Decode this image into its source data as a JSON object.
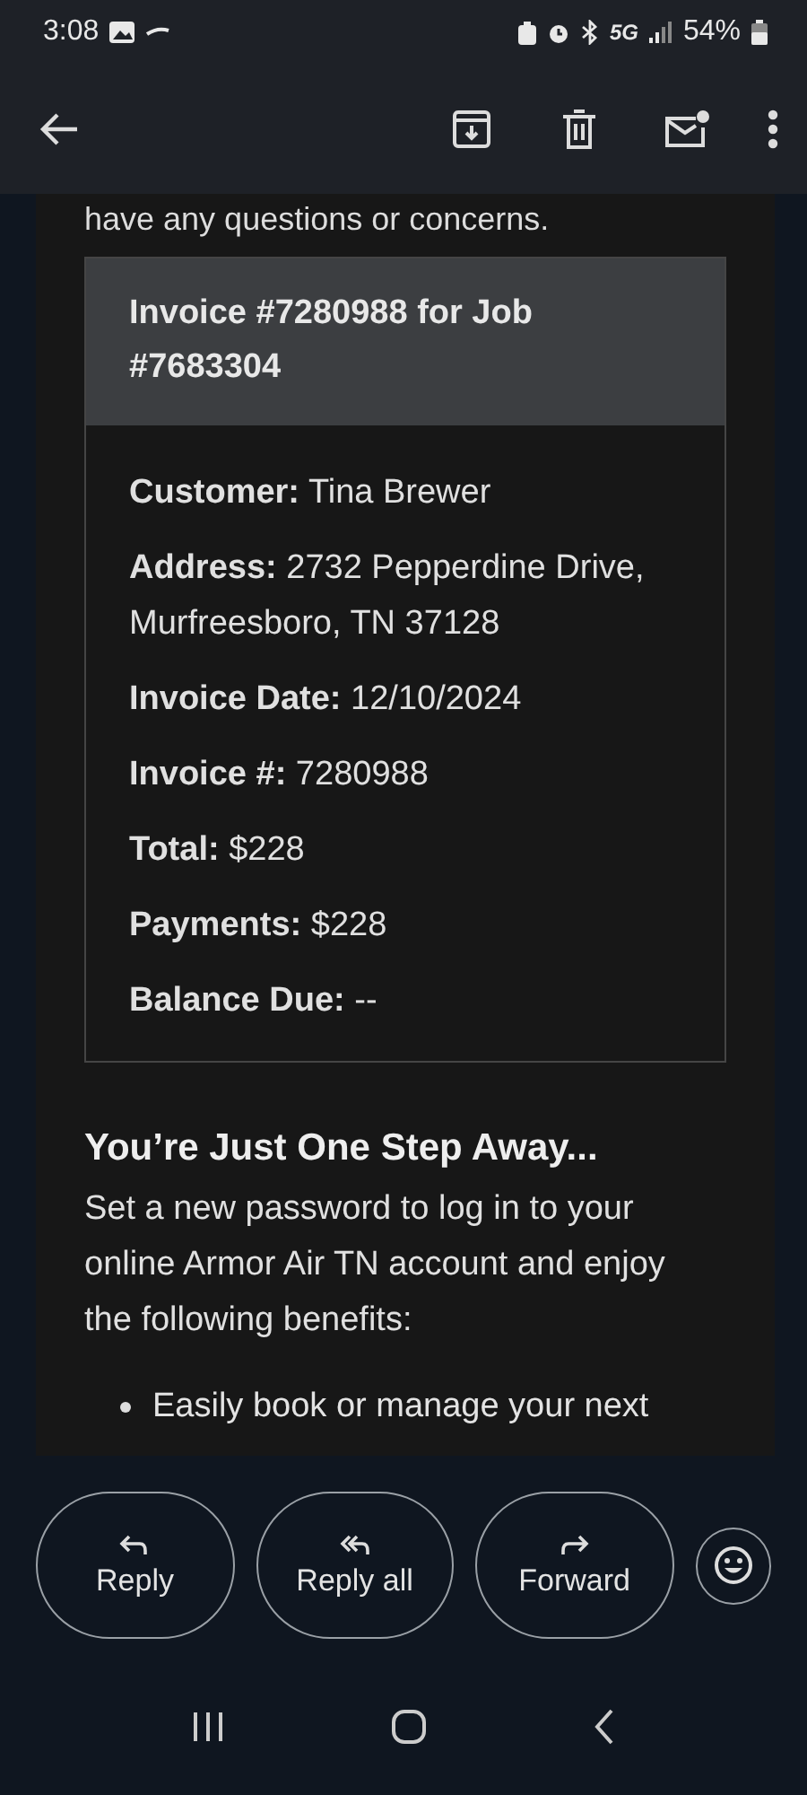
{
  "status_bar": {
    "time": "3:08",
    "network": "5G",
    "battery": "54%"
  },
  "email": {
    "intro": "have any questions or concerns.",
    "invoice": {
      "title": "Invoice #7280988 for Job #7683304",
      "fields": [
        {
          "text": "**Customer:** Tina Brewer"
        },
        {
          "text": "**Address:** 2732 Pepperdine Drive, Murfreesboro, TN 37128"
        },
        {
          "text": "**Invoice Date:** 12/10/2024"
        },
        {
          "text": "**Invoice #:** 7280988"
        },
        {
          "text": "**Total:** $228"
        },
        {
          "text": "**Payments:** $228"
        },
        {
          "text": "**Balance Due:** --"
        }
      ]
    },
    "heading": "You’re Just One Step Away...",
    "paragraph": "Set a new password to log in to your online Armor Air TN account and enjoy the following benefits:",
    "bullets": [
      "Easily book or manage your next"
    ]
  },
  "actions": [
    {
      "kind": "reply",
      "label": "Reply"
    },
    {
      "kind": "reply_all",
      "label": "Reply all"
    },
    {
      "kind": "forward",
      "label": "Forward"
    }
  ]
}
